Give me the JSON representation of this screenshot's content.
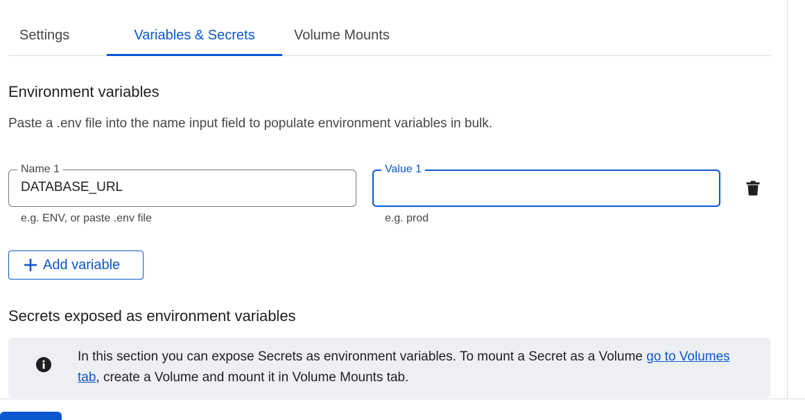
{
  "tabs": [
    {
      "label": "Settings",
      "active": false
    },
    {
      "label": "Variables & Secrets",
      "active": true
    },
    {
      "label": "Volume Mounts",
      "active": false
    }
  ],
  "env": {
    "title": "Environment variables",
    "description": "Paste a .env file into the name input field to populate environment variables in bulk.",
    "rows": [
      {
        "name_label": "Name 1",
        "name_value": "DATABASE_URL",
        "name_hint": "e.g. ENV, or paste .env file",
        "value_label": "Value 1",
        "value_value": "",
        "value_hint": "e.g. prod",
        "delete_icon": "trash-icon"
      }
    ],
    "add_button_label": "Add variable",
    "add_icon": "plus-icon"
  },
  "secrets": {
    "title": "Secrets exposed as environment variables",
    "info_icon": "info-icon",
    "info_text_before": "In this section you can expose Secrets as environment variables. To mount a Secret as a Volume ",
    "info_link": "go to Volumes tab",
    "info_text_after": ", create a Volume and mount it in Volume Mounts tab."
  },
  "colors": {
    "accent": "#0b57d0",
    "text": "#1f1f1f",
    "muted": "#444746",
    "info_bg": "#edeff3"
  }
}
